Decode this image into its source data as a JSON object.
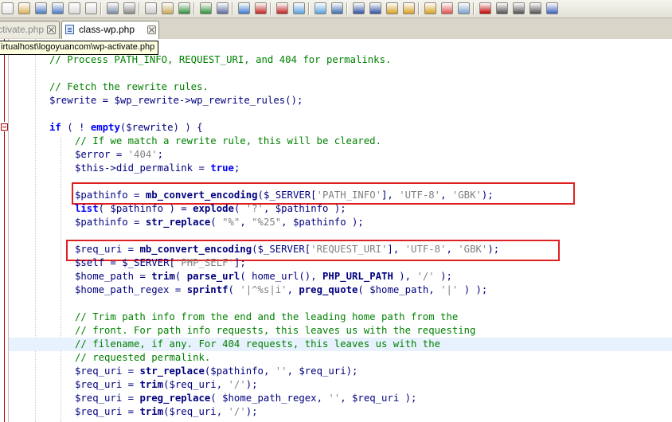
{
  "tabs": [
    {
      "label": "ctivate.php",
      "active": false
    },
    {
      "label": "class-wp.php",
      "active": true
    }
  ],
  "tooltip": "irtualhost\\logoyuancom\\wp-activate.php",
  "toolbar_icons": [
    "new-file",
    "open-folder",
    "save",
    "save-all",
    "close",
    "close-all",
    "print",
    "cut",
    "copy",
    "paste",
    "undo",
    "redo",
    "find",
    "replace",
    "zoom-in",
    "zoom-out",
    "sync-vertical",
    "sync-horizontal",
    "word-wrap",
    "show-all-chars",
    "indent-guide",
    "user-lang",
    "folder-as-workspace",
    "function-list",
    "doc-map",
    "monitor",
    "record-macro",
    "stop-record",
    "play-macro",
    "run-macro",
    "save-macro"
  ],
  "lines": [
    [
      {
        "t": "// Process PATH_INFO, REQUEST_URI, and 404 for permalinks.",
        "c": "cmt"
      }
    ],
    [],
    [
      {
        "t": "// Fetch the rewrite rules.",
        "c": "cmt"
      }
    ],
    [
      {
        "t": "$rewrite",
        "c": "var"
      },
      {
        "t": " = ",
        "c": "op"
      },
      {
        "t": "$wp_rewrite",
        "c": "var"
      },
      {
        "t": "->",
        "c": "op"
      },
      {
        "t": "wp_rewrite_rules",
        "c": "var"
      },
      {
        "t": "();",
        "c": "op"
      }
    ],
    [],
    [
      {
        "t": "if",
        "c": "kw"
      },
      {
        "t": " ( ! ",
        "c": "op"
      },
      {
        "t": "empty",
        "c": "kw"
      },
      {
        "t": "(",
        "c": "op"
      },
      {
        "t": "$rewrite",
        "c": "var"
      },
      {
        "t": ") ) {",
        "c": "op"
      }
    ],
    [
      {
        "t": "// If we match a rewrite rule, this will be cleared.",
        "c": "cmt"
      }
    ],
    [
      {
        "t": "$error",
        "c": "var"
      },
      {
        "t": " = ",
        "c": "op"
      },
      {
        "t": "'404'",
        "c": "str"
      },
      {
        "t": ";",
        "c": "op"
      }
    ],
    [
      {
        "t": "$this",
        "c": "var"
      },
      {
        "t": "->",
        "c": "op"
      },
      {
        "t": "did_permalink",
        "c": "var"
      },
      {
        "t": " = ",
        "c": "op"
      },
      {
        "t": "true",
        "c": "kw"
      },
      {
        "t": ";",
        "c": "op"
      }
    ],
    [],
    [
      {
        "t": "$pathinfo",
        "c": "var"
      },
      {
        "t": " = ",
        "c": "op"
      },
      {
        "t": "mb_convert_encoding",
        "c": "fn"
      },
      {
        "t": "(",
        "c": "op"
      },
      {
        "t": "$_SERVER",
        "c": "var"
      },
      {
        "t": "[",
        "c": "op"
      },
      {
        "t": "'PATH_INFO'",
        "c": "str"
      },
      {
        "t": "], ",
        "c": "op"
      },
      {
        "t": "'UTF-8'",
        "c": "str"
      },
      {
        "t": ", ",
        "c": "op"
      },
      {
        "t": "'GBK'",
        "c": "str"
      },
      {
        "t": ");",
        "c": "op"
      }
    ],
    [
      {
        "t": "list",
        "c": "kw"
      },
      {
        "t": "( ",
        "c": "op"
      },
      {
        "t": "$pathinfo",
        "c": "var"
      },
      {
        "t": " ) = ",
        "c": "op"
      },
      {
        "t": "explode",
        "c": "fn"
      },
      {
        "t": "( ",
        "c": "op"
      },
      {
        "t": "'?'",
        "c": "str"
      },
      {
        "t": ", ",
        "c": "op"
      },
      {
        "t": "$pathinfo",
        "c": "var"
      },
      {
        "t": " );",
        "c": "op"
      }
    ],
    [
      {
        "t": "$pathinfo",
        "c": "var"
      },
      {
        "t": " = ",
        "c": "op"
      },
      {
        "t": "str_replace",
        "c": "fn"
      },
      {
        "t": "( ",
        "c": "op"
      },
      {
        "t": "\"%\"",
        "c": "str"
      },
      {
        "t": ", ",
        "c": "op"
      },
      {
        "t": "\"%25\"",
        "c": "str"
      },
      {
        "t": ", ",
        "c": "op"
      },
      {
        "t": "$pathinfo",
        "c": "var"
      },
      {
        "t": " );",
        "c": "op"
      }
    ],
    [],
    [
      {
        "t": "$req_uri",
        "c": "var"
      },
      {
        "t": " = ",
        "c": "op"
      },
      {
        "t": "mb_convert_encoding",
        "c": "fn"
      },
      {
        "t": "(",
        "c": "op"
      },
      {
        "t": "$_SERVER",
        "c": "var"
      },
      {
        "t": "[",
        "c": "op"
      },
      {
        "t": "'REQUEST_URI'",
        "c": "str"
      },
      {
        "t": "], ",
        "c": "op"
      },
      {
        "t": "'UTF-8'",
        "c": "str"
      },
      {
        "t": ", ",
        "c": "op"
      },
      {
        "t": "'GBK'",
        "c": "str"
      },
      {
        "t": ");",
        "c": "op"
      }
    ],
    [
      {
        "t": "$self",
        "c": "var"
      },
      {
        "t": " = ",
        "c": "op"
      },
      {
        "t": "$_SERVER",
        "c": "var"
      },
      {
        "t": "[",
        "c": "op"
      },
      {
        "t": "'PHP_SELF'",
        "c": "str"
      },
      {
        "t": "];",
        "c": "op"
      }
    ],
    [
      {
        "t": "$home_path",
        "c": "var"
      },
      {
        "t": " = ",
        "c": "op"
      },
      {
        "t": "trim",
        "c": "fn"
      },
      {
        "t": "( ",
        "c": "op"
      },
      {
        "t": "parse_url",
        "c": "fn"
      },
      {
        "t": "( ",
        "c": "op"
      },
      {
        "t": "home_url",
        "c": "var"
      },
      {
        "t": "(), ",
        "c": "op"
      },
      {
        "t": "PHP_URL_PATH",
        "c": "fn"
      },
      {
        "t": " ), ",
        "c": "op"
      },
      {
        "t": "'/'",
        "c": "str"
      },
      {
        "t": " );",
        "c": "op"
      }
    ],
    [
      {
        "t": "$home_path_regex",
        "c": "var"
      },
      {
        "t": " = ",
        "c": "op"
      },
      {
        "t": "sprintf",
        "c": "fn"
      },
      {
        "t": "( ",
        "c": "op"
      },
      {
        "t": "'|^%s|i'",
        "c": "str"
      },
      {
        "t": ", ",
        "c": "op"
      },
      {
        "t": "preg_quote",
        "c": "fn"
      },
      {
        "t": "( ",
        "c": "op"
      },
      {
        "t": "$home_path",
        "c": "var"
      },
      {
        "t": ", ",
        "c": "op"
      },
      {
        "t": "'|'",
        "c": "str"
      },
      {
        "t": " ) );",
        "c": "op"
      }
    ],
    [],
    [
      {
        "t": "// Trim path info from the end and the leading home path from the",
        "c": "cmt"
      }
    ],
    [
      {
        "t": "// front. For path info requests, this leaves us with the requesting",
        "c": "cmt"
      }
    ],
    [
      {
        "t": "// filename, if any. For 404 requests, this leaves us with the",
        "c": "cmt"
      }
    ],
    [
      {
        "t": "// requested permalink.",
        "c": "cmt"
      }
    ],
    [
      {
        "t": "$req_uri",
        "c": "var"
      },
      {
        "t": " = ",
        "c": "op"
      },
      {
        "t": "str_replace",
        "c": "fn"
      },
      {
        "t": "(",
        "c": "op"
      },
      {
        "t": "$pathinfo",
        "c": "var"
      },
      {
        "t": ", ",
        "c": "op"
      },
      {
        "t": "''",
        "c": "str"
      },
      {
        "t": ", ",
        "c": "op"
      },
      {
        "t": "$req_uri",
        "c": "var"
      },
      {
        "t": ");",
        "c": "op"
      }
    ],
    [
      {
        "t": "$req_uri",
        "c": "var"
      },
      {
        "t": " = ",
        "c": "op"
      },
      {
        "t": "trim",
        "c": "fn"
      },
      {
        "t": "(",
        "c": "op"
      },
      {
        "t": "$req_uri",
        "c": "var"
      },
      {
        "t": ", ",
        "c": "op"
      },
      {
        "t": "'/'",
        "c": "str"
      },
      {
        "t": ");",
        "c": "op"
      }
    ],
    [
      {
        "t": "$req_uri",
        "c": "var"
      },
      {
        "t": " = ",
        "c": "op"
      },
      {
        "t": "preg_replace",
        "c": "fn"
      },
      {
        "t": "( ",
        "c": "op"
      },
      {
        "t": "$home_path_regex",
        "c": "var"
      },
      {
        "t": ", ",
        "c": "op"
      },
      {
        "t": "''",
        "c": "str"
      },
      {
        "t": ", ",
        "c": "op"
      },
      {
        "t": "$req_uri",
        "c": "var"
      },
      {
        "t": " );",
        "c": "op"
      }
    ],
    [
      {
        "t": "$req_uri",
        "c": "var"
      },
      {
        "t": " = ",
        "c": "op"
      },
      {
        "t": "trim",
        "c": "fn"
      },
      {
        "t": "(",
        "c": "op"
      },
      {
        "t": "$req_uri",
        "c": "var"
      },
      {
        "t": ", ",
        "c": "op"
      },
      {
        "t": "'/'",
        "c": "str"
      },
      {
        "t": ");",
        "c": "op"
      }
    ]
  ],
  "colors": {
    "comment": "#008000",
    "keyword": "#0000ff",
    "string": "#808080",
    "variable": "#000080",
    "highlight_box": "#e02020",
    "current_line": "#e8f2fe"
  }
}
